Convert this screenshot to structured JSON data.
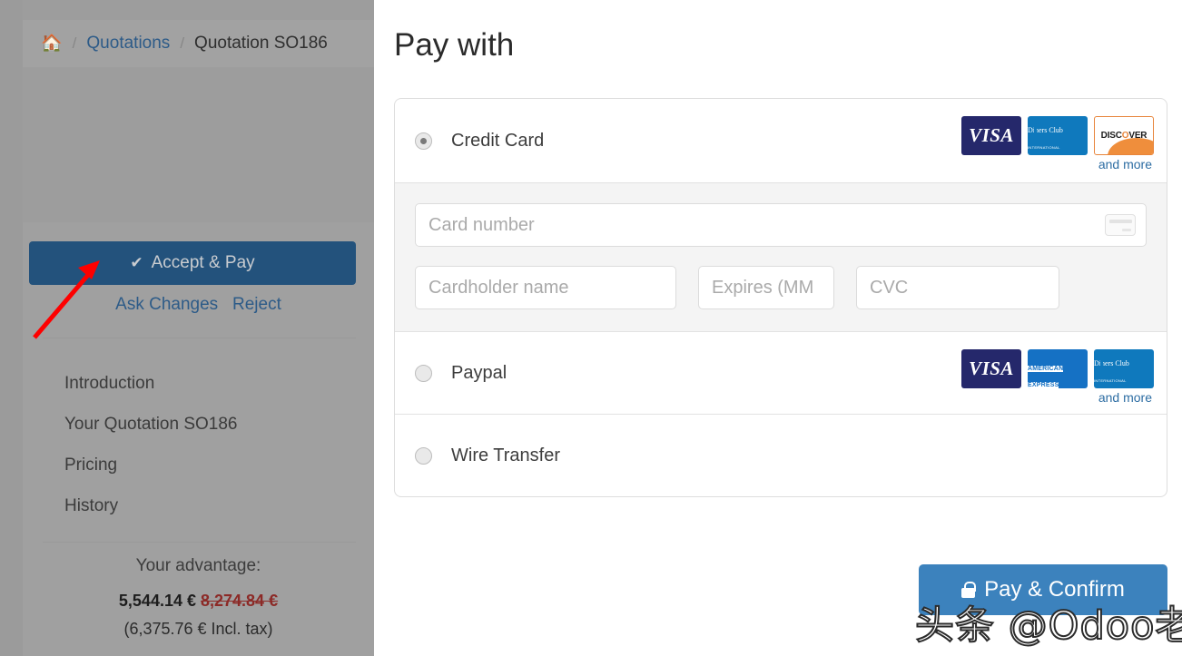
{
  "background_page": {
    "breadcrumb": {
      "home_icon": "home-icon",
      "separator": "/",
      "items": [
        {
          "label": "Quotations",
          "link": true
        },
        {
          "label": "Quotation SO186",
          "link": false
        }
      ]
    },
    "actions": {
      "accept_pay_label": "Accept & Pay",
      "accept_pay_check_icon": "check-icon",
      "ask_changes_label": "Ask Changes",
      "reject_label": "Reject"
    },
    "nav_items": [
      {
        "label": "Introduction"
      },
      {
        "label": "Your Quotation SO186"
      },
      {
        "label": "Pricing"
      },
      {
        "label": "History"
      }
    ],
    "advantage": {
      "title": "Your advantage:",
      "new_price": "5,544.14 €",
      "old_price": "8,274.84 €",
      "incl_tax": "(6,375.76 € Incl. tax)"
    },
    "annotation": {
      "arrow": "red-arrow-pointer"
    }
  },
  "modal": {
    "title": "Pay with",
    "methods": [
      {
        "id": "credit-card",
        "label": "Credit Card",
        "selected": true,
        "brands": [
          "VISA",
          "Diners Club INTERNATIONAL",
          "DISCOVER"
        ],
        "and_more_label": "and more"
      },
      {
        "id": "paypal",
        "label": "Paypal",
        "selected": false,
        "brands": [
          "VISA",
          "AMERICAN EXPRESS",
          "Diners Club INTERNATIONAL"
        ],
        "and_more_label": "and more"
      },
      {
        "id": "wire-transfer",
        "label": "Wire Transfer",
        "selected": false,
        "brands": [],
        "and_more_label": ""
      }
    ],
    "card_form": {
      "card_number": {
        "placeholder": "Card number",
        "value": "",
        "icon": "credit-card-icon"
      },
      "cardholder_name": {
        "placeholder": "Cardholder name",
        "value": ""
      },
      "expires": {
        "placeholder": "Expires (MM",
        "value": ""
      },
      "cvc": {
        "placeholder": "CVC",
        "value": ""
      }
    },
    "submit": {
      "label": "Pay & Confirm",
      "lock_icon": "lock-icon",
      "color": "#3c82bd"
    }
  },
  "watermark": {
    "text": "头条 @Odoo老杨"
  },
  "brand_text": {
    "visa": "VISA",
    "diners_line1": "Diners Club",
    "diners_line2": "INTERNATIONAL",
    "discover_pre": "DISC",
    "discover_o": "O",
    "discover_post": "VER",
    "amex_line1": "AMERICAN",
    "amex_line2": "EXPRESS"
  }
}
